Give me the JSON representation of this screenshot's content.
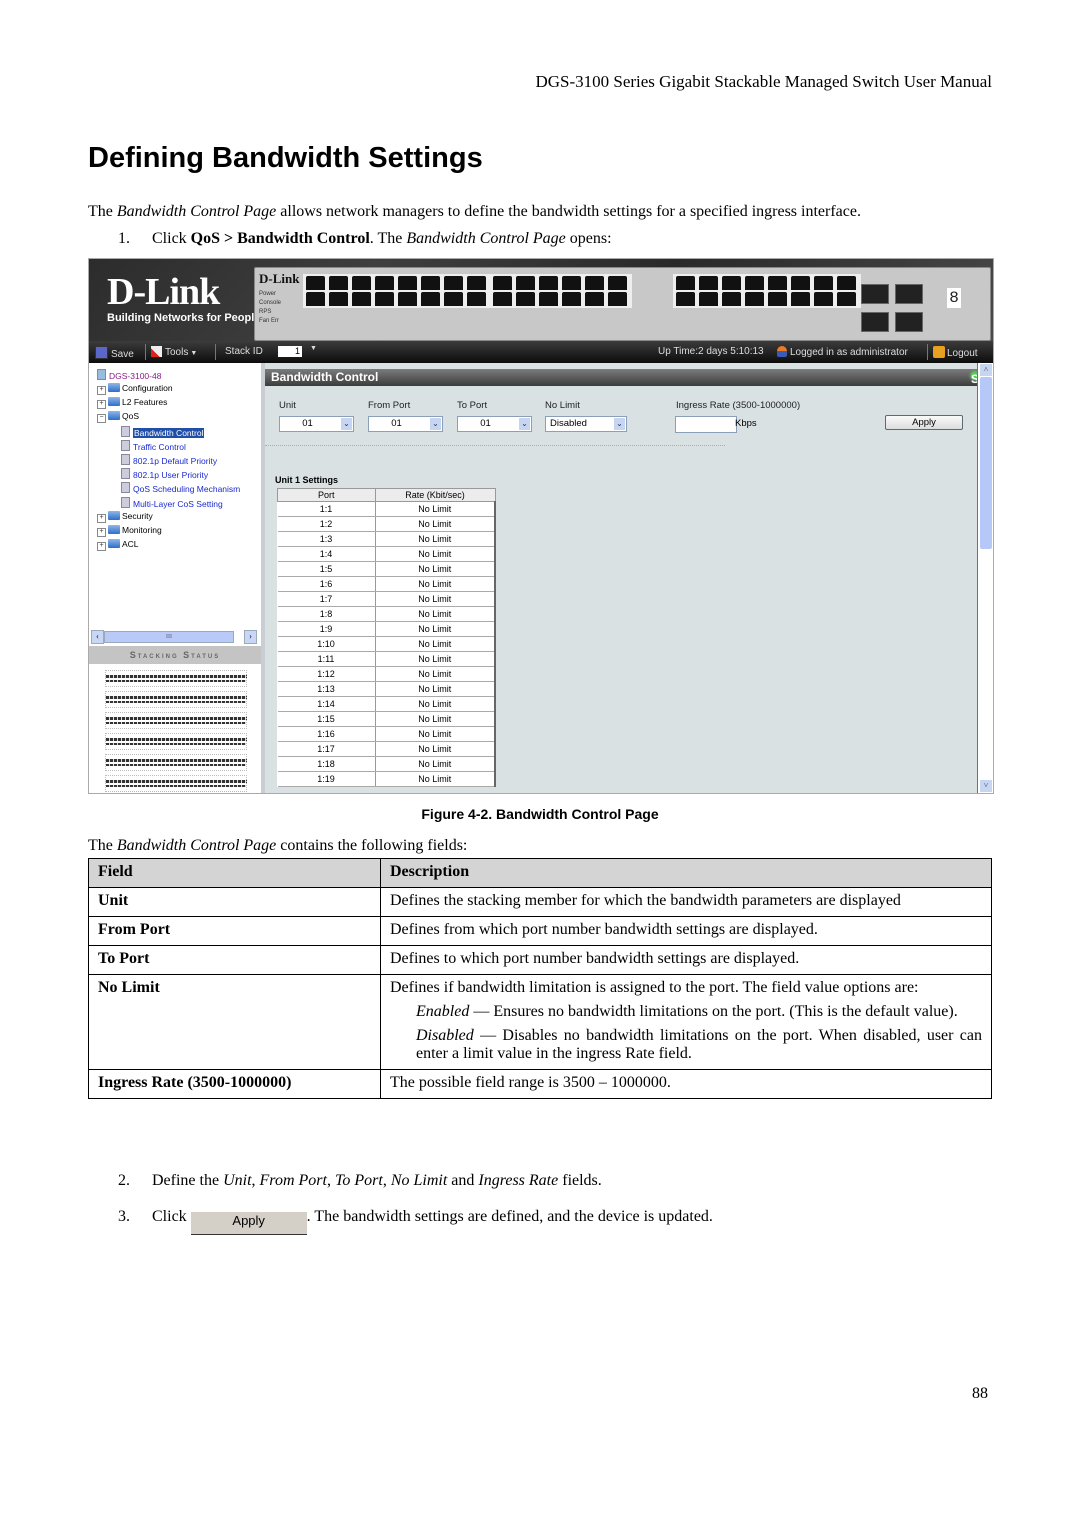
{
  "running_header": "DGS-3100 Series Gigabit Stackable Managed Switch User Manual",
  "heading": "Defining Bandwidth Settings",
  "intro": {
    "pre": "The ",
    "italic": "Bandwidth Control Page",
    "post": " allows network managers to define the bandwidth settings for a specified ingress interface."
  },
  "step1": {
    "num": "1.",
    "pre": "Click ",
    "bold": "QoS > Bandwidth Control",
    "mid": ". The ",
    "italic": "Bandwidth Control Page",
    "post": " opens:"
  },
  "ui": {
    "logo": "D-Link",
    "logo_tagline": "Building Networks for People",
    "device_brand": "D-Link",
    "device_leds": [
      "Power",
      "Console",
      "RPS",
      "Fan Err"
    ],
    "unit_id_digit": "8",
    "toolbar": {
      "save": "Save",
      "tools": "Tools",
      "stack_id_label": "Stack ID",
      "stack_id_value": "1",
      "uptime": "Up Time:2 days 5:10:13",
      "logged_in": "Logged in as administrator",
      "logout": "Logout"
    },
    "tree": {
      "root": "DGS-3100-48",
      "items": [
        {
          "label": "Configuration",
          "expander": "+"
        },
        {
          "label": "L2 Features",
          "expander": "+"
        },
        {
          "label": "QoS",
          "expander": "-"
        },
        {
          "label": "Bandwidth Control",
          "child": true,
          "selected": true
        },
        {
          "label": "Traffic Control",
          "child": true
        },
        {
          "label": "802.1p Default Priority",
          "child": true
        },
        {
          "label": "802.1p User Priority",
          "child": true
        },
        {
          "label": "QoS Scheduling Mechanism",
          "child": true
        },
        {
          "label": "Multi-Layer CoS Setting",
          "child": true
        },
        {
          "label": "Security",
          "expander": "+"
        },
        {
          "label": "Monitoring",
          "expander": "+"
        },
        {
          "label": "ACL",
          "expander": "+"
        }
      ],
      "scroll_thumb": "III"
    },
    "stacking_status": "Stacking Status",
    "panel": {
      "title": "Bandwidth Control",
      "safeguard": "Safeguard",
      "fields": {
        "unit_label": "Unit",
        "unit_value": "01",
        "from_port_label": "From Port",
        "from_port_value": "01",
        "to_port_label": "To Port",
        "to_port_value": "01",
        "no_limit_label": "No Limit",
        "no_limit_value": "Disabled",
        "ingress_label": "Ingress Rate (3500-1000000)",
        "ingress_value": "",
        "kbps": "Kbps",
        "apply": "Apply"
      },
      "unit_settings_title": "Unit 1 Settings",
      "table_headers": [
        "Port",
        "Rate (Kbit/sec)"
      ],
      "rows": [
        [
          "1:1",
          "No Limit"
        ],
        [
          "1:2",
          "No Limit"
        ],
        [
          "1:3",
          "No Limit"
        ],
        [
          "1:4",
          "No Limit"
        ],
        [
          "1:5",
          "No Limit"
        ],
        [
          "1:6",
          "No Limit"
        ],
        [
          "1:7",
          "No Limit"
        ],
        [
          "1:8",
          "No Limit"
        ],
        [
          "1:9",
          "No Limit"
        ],
        [
          "1:10",
          "No Limit"
        ],
        [
          "1:11",
          "No Limit"
        ],
        [
          "1:12",
          "No Limit"
        ],
        [
          "1:13",
          "No Limit"
        ],
        [
          "1:14",
          "No Limit"
        ],
        [
          "1:15",
          "No Limit"
        ],
        [
          "1:16",
          "No Limit"
        ],
        [
          "1:17",
          "No Limit"
        ],
        [
          "1:18",
          "No Limit"
        ],
        [
          "1:19",
          "No Limit"
        ]
      ]
    }
  },
  "figure_caption": "Figure 4-2. Bandwidth Control Page",
  "fields_intro": {
    "pre": "The ",
    "italic": "Bandwidth Control Page",
    "post": " contains the following fields:"
  },
  "field_table": {
    "headers": [
      "Field",
      "Description"
    ],
    "rows": [
      {
        "field": "Unit",
        "desc": "Defines the stacking member for which the bandwidth parameters are displayed"
      },
      {
        "field": "From Port",
        "desc": "Defines from which port number bandwidth settings are displayed."
      },
      {
        "field": "To Port",
        "desc": "Defines to which port number bandwidth settings are displayed."
      },
      {
        "field": "No Limit",
        "desc": "Defines if bandwidth limitation is assigned to the port. The field value options are:",
        "opt1_term": "Enabled",
        "opt1_text": " — Ensures no bandwidth limitations on the port. (This is the default value).",
        "opt2_term": "Disabled",
        "opt2_text": " — Disables no bandwidth limitations on the port. When disabled, user can enter a limit value in the ingress Rate field."
      },
      {
        "field": "Ingress Rate (3500-1000000)",
        "desc": "The possible field range is 3500 – 1000000."
      }
    ]
  },
  "step2": {
    "num": "2.",
    "pre": "Define the ",
    "i1": "Unit",
    "s1": ", ",
    "i2": "From Port",
    "s2": ", ",
    "i3": "To Port",
    "s3": ", ",
    "i4": "No Limit",
    "s4": " and ",
    "i5": "Ingress Rate",
    "post": " fields."
  },
  "step3": {
    "num": "3.",
    "pre": "Click ",
    "button": "Apply",
    "post": ". The bandwidth settings are defined, and the device is updated."
  },
  "page_number": "88"
}
